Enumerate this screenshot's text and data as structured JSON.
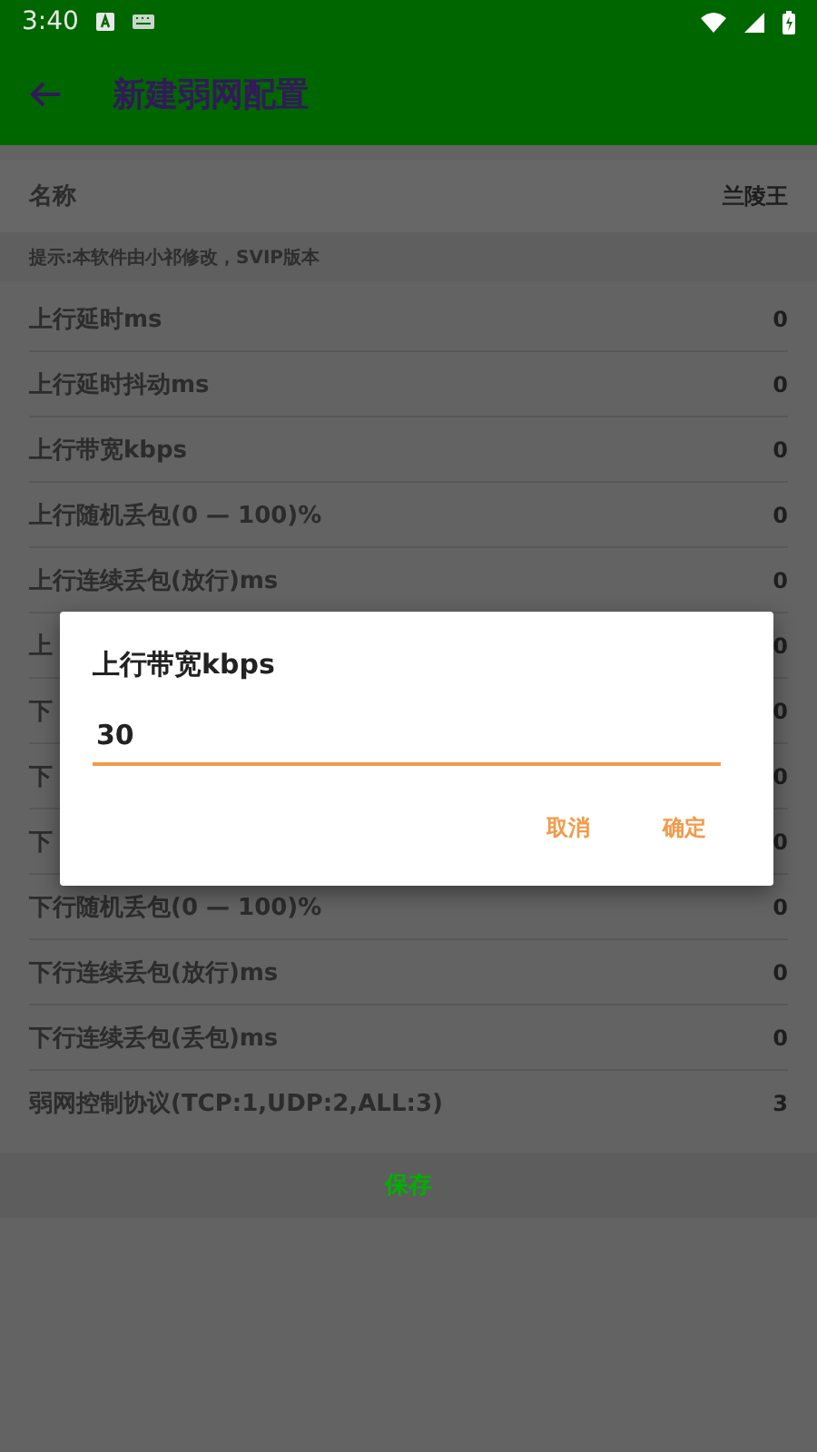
{
  "status_bar": {
    "time": "3:40"
  },
  "app_bar": {
    "title": "新建弱网配置"
  },
  "name_field": {
    "label": "名称",
    "value": "兰陵王"
  },
  "hint": "提示:本软件由小祁修改，SVIP版本",
  "settings": [
    {
      "label": "上行延时ms",
      "value": "0"
    },
    {
      "label": "上行延时抖动ms",
      "value": "0"
    },
    {
      "label": "上行带宽kbps",
      "value": "0"
    },
    {
      "label": "上行随机丢包(0 — 100)%",
      "value": "0"
    },
    {
      "label": "上行连续丢包(放行)ms",
      "value": "0"
    },
    {
      "label": "上",
      "value": "0"
    },
    {
      "label": "下",
      "value": "0"
    },
    {
      "label": "下",
      "value": "0"
    },
    {
      "label": "下",
      "value": "0"
    },
    {
      "label": "下行随机丢包(0 — 100)%",
      "value": "0"
    },
    {
      "label": "下行连续丢包(放行)ms",
      "value": "0"
    },
    {
      "label": "下行连续丢包(丢包)ms",
      "value": "0"
    },
    {
      "label": "弱网控制协议(TCP:1,UDP:2,ALL:3)",
      "value": "3"
    }
  ],
  "save_button": "保存",
  "dialog": {
    "title": "上行带宽kbps",
    "value": "30",
    "buttons": [
      "取消",
      "确定"
    ]
  }
}
